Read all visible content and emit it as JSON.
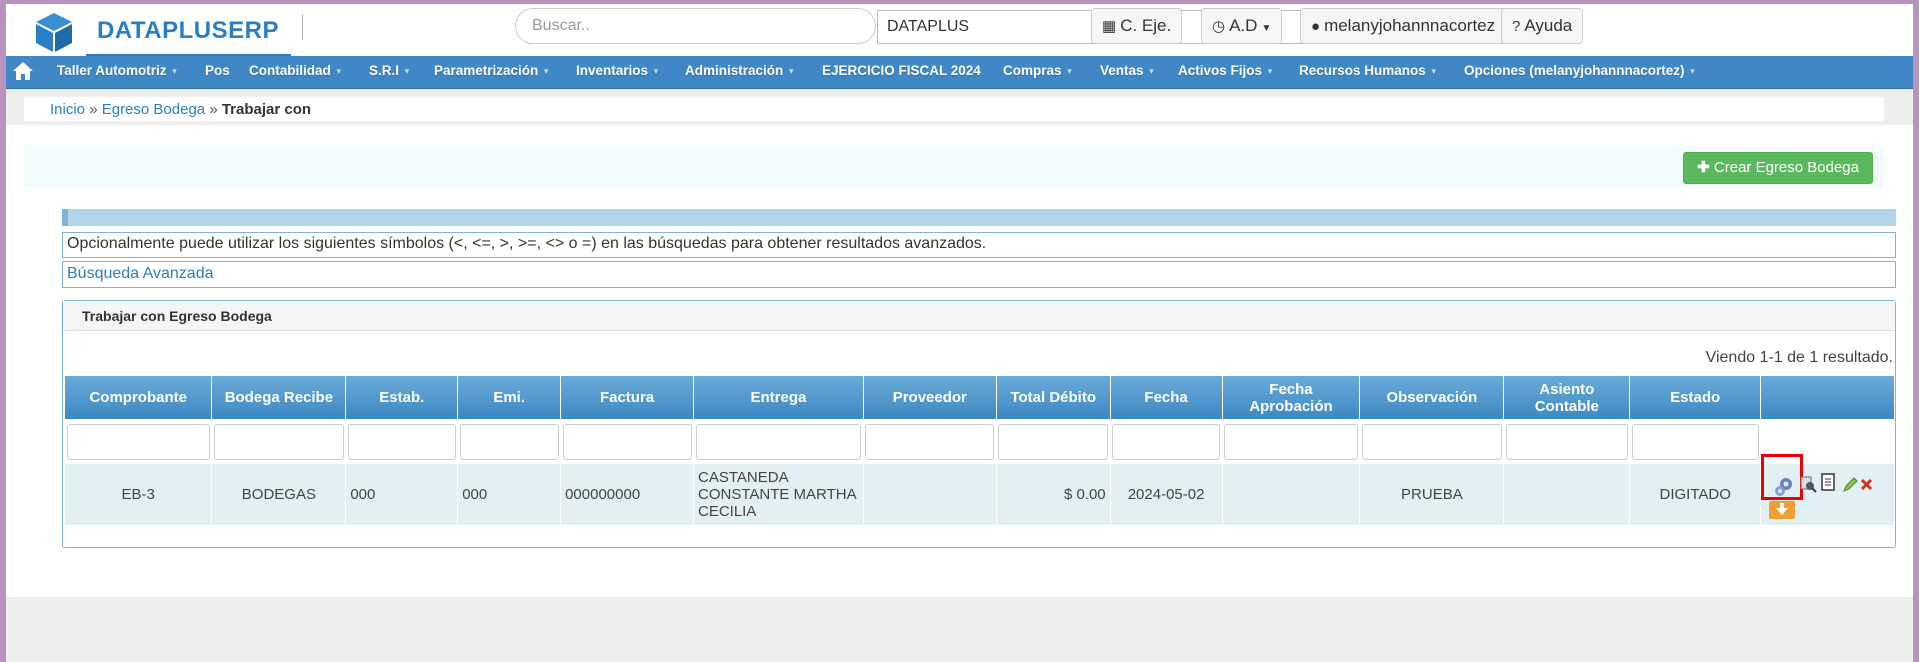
{
  "header": {
    "brand": "DATAPLUSERP",
    "search_placeholder": "Buscar..",
    "company_value": "DATAPLUS",
    "fiscal_button": "C. Eje.",
    "ad_button": "A.D",
    "user_button": "melanyjohannnacortez",
    "help_button": "Ayuda"
  },
  "nav": {
    "items": [
      {
        "label": "Taller Automotriz"
      },
      {
        "label": "Pos"
      },
      {
        "label": "Contabilidad"
      },
      {
        "label": "S.R.I"
      },
      {
        "label": "Parametrización"
      },
      {
        "label": "Inventarios"
      },
      {
        "label": "Administración"
      },
      {
        "label": "EJERCICIO FISCAL 2024"
      },
      {
        "label": "Compras"
      },
      {
        "label": "Ventas"
      },
      {
        "label": "Activos Fijos"
      },
      {
        "label": "Recursos Humanos"
      },
      {
        "label": "Opciones (melanyjohannnacortez)"
      }
    ]
  },
  "breadcrumb": {
    "home": "Inicio",
    "sep": "»",
    "section": "Egreso Bodega",
    "current": "Trabajar con"
  },
  "actions": {
    "create_label": "Crear Egreso Bodega"
  },
  "info": {
    "hint": "Opcionalmente puede utilizar los siguientes símbolos (<, <=, >, >=, <> o =) en las búsquedas para obtener resultados avanzados.",
    "advanced_search": "Búsqueda Avanzada"
  },
  "panel": {
    "title": "Trabajar con Egreso Bodega",
    "summary": "Viendo 1-1 de 1 resultado."
  },
  "table": {
    "columns": [
      {
        "label": "Comprobante"
      },
      {
        "label": "Bodega Recibe"
      },
      {
        "label": "Estab."
      },
      {
        "label": "Emi."
      },
      {
        "label": "Factura"
      },
      {
        "label": "Entrega"
      },
      {
        "label": "Proveedor"
      },
      {
        "label": "Total Débito"
      },
      {
        "label": "Fecha"
      },
      {
        "label": "Fecha Aprobación"
      },
      {
        "label": "Observación"
      },
      {
        "label": "Asiento Contable"
      },
      {
        "label": "Estado"
      }
    ],
    "rows": [
      {
        "comprobante": "EB-3",
        "bodega_recibe": "BODEGAS",
        "estab": "000",
        "emi": "000",
        "factura": "000000000",
        "entrega": "CASTANEDA CONSTANTE MARTHA CECILIA",
        "proveedor": "",
        "total_debito": "$ 0.00",
        "fecha": "2024-05-02",
        "fecha_aprobacion": "",
        "observacion": "PRUEBA",
        "asiento_contable": "",
        "estado": "DIGITADO"
      }
    ]
  },
  "row_action_icons": [
    "gears-icon",
    "view-detail-icon",
    "document-icon",
    "edit-pencil-icon",
    "delete-icon",
    "download-icon"
  ],
  "colors": {
    "brand": "#2a7ec3",
    "nav": "#3f88c5",
    "create_button": "#5cb85c",
    "highlight": "#ee0000"
  }
}
